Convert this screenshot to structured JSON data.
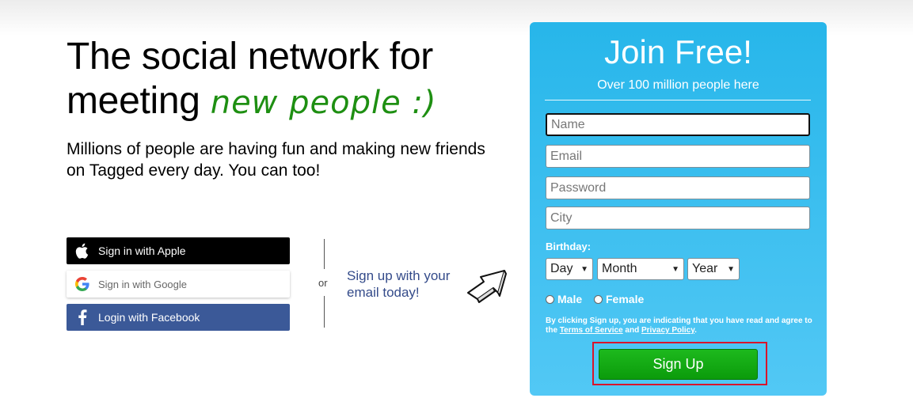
{
  "hero": {
    "title_line1": "The social network for",
    "title_line2_prefix": "meeting",
    "title_highlight": "new people :)",
    "subtitle": "Millions of people are having fun and making new friends on Tagged every day. You can too!"
  },
  "social": {
    "apple_label": "Sign in with Apple",
    "google_label": "Sign in with Google",
    "facebook_label": "Login with Facebook",
    "or_label": "or",
    "email_prompt": "Sign up with your email today!"
  },
  "signup_panel": {
    "title": "Join Free!",
    "subtitle": "Over 100 million people here",
    "name_placeholder": "Name",
    "email_placeholder": "Email",
    "password_placeholder": "Password",
    "city_placeholder": "City",
    "birthday_label": "Birthday:",
    "day_value": "Day",
    "month_value": "Month",
    "year_value": "Year",
    "male_label": "Male",
    "female_label": "Female",
    "terms_prefix": "By clicking Sign up, you are indicating that you have read and agree to the",
    "terms_link": "Terms of Service",
    "terms_and": "and",
    "privacy_link": "Privacy Policy",
    "terms_suffix": ".",
    "signup_label": "Sign Up"
  },
  "colors": {
    "panel": "#27b6ea",
    "accent_green": "#1e8f12",
    "button_green": "#14aa14",
    "facebook": "#3b5998",
    "highlight": "#d9142b"
  },
  "icons": {
    "apple": "apple-icon",
    "google": "google-icon",
    "facebook": "facebook-icon",
    "arrow": "arrow-icon"
  }
}
